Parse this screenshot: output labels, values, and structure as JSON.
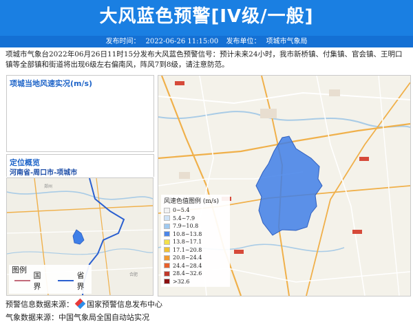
{
  "header": {
    "title": "大风蓝色预警[IV级/一般]",
    "publish_label": "发布时间：",
    "publish_time": "2022-06-26 11:15:00",
    "unit_label": "发布单位：",
    "unit": "项城市气象局",
    "color": "#1a7fe2"
  },
  "description": "项城市气象台2022年06月26日11时15分发布大风蓝色预警信号：预计未来24小时，我市新桥镇、付集镇、官会镇、王明口镇等全部镇和街道将出现6级左右偏南风，阵风7到8级，请注意防范。",
  "wind_panel": {
    "title": "项城当地风速实况(m/s)"
  },
  "location_panel": {
    "title": "定位概览",
    "subtitle": "河南省-周口市-项城市"
  },
  "wind_legend": {
    "title": "风速色值图例 (m/s)",
    "items": [
      {
        "label": "0~5.4",
        "color": "#f2f2f2"
      },
      {
        "label": "5.4~7.9",
        "color": "#cfe3f7"
      },
      {
        "label": "7.9~10.8",
        "color": "#9fc9f0"
      },
      {
        "label": "10.8~13.8",
        "color": "#4b86e8"
      },
      {
        "label": "13.8~17.1",
        "color": "#f3e14a"
      },
      {
        "label": "17.1~20.8",
        "color": "#f1c232"
      },
      {
        "label": "20.8~24.4",
        "color": "#f29a2e"
      },
      {
        "label": "24.4~28.4",
        "color": "#e8602c"
      },
      {
        "label": "28.4~32.6",
        "color": "#c0392b"
      },
      {
        "label": ">32.6",
        "color": "#8b1010"
      }
    ]
  },
  "mini_legend": {
    "title": "图例",
    "items": [
      {
        "label": "国界",
        "color": "#c26a7a"
      },
      {
        "label": "省界",
        "color": "#2a5fd0"
      }
    ]
  },
  "minimap_labels": [
    "郑州",
    "合肥"
  ],
  "footer": {
    "warning_source_label": "预警信息数据来源：",
    "warning_source": "国家预警信息发布中心",
    "weather_source_label": "气象数据来源：",
    "weather_source": "中国气象局全国自动站实况"
  }
}
